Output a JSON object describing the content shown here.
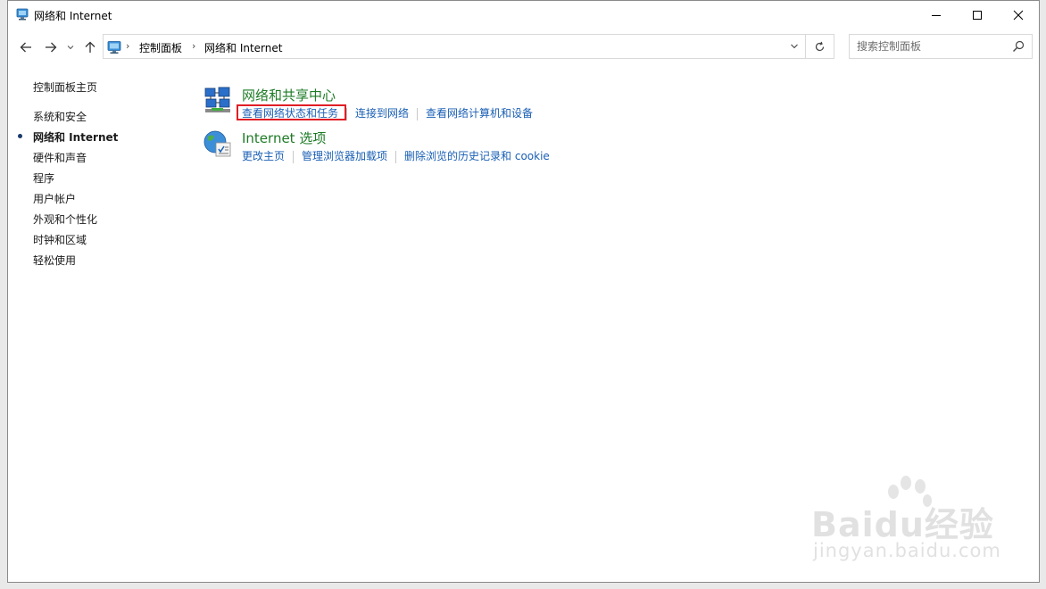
{
  "window": {
    "title": "网络和 Internet"
  },
  "address": {
    "crumbs": [
      "控制面板",
      "网络和 Internet"
    ]
  },
  "search": {
    "placeholder": "搜索控制面板"
  },
  "sidebar": {
    "home": "控制面板主页",
    "items": [
      {
        "label": "系统和安全",
        "active": false
      },
      {
        "label": "网络和 Internet",
        "active": true
      },
      {
        "label": "硬件和声音",
        "active": false
      },
      {
        "label": "程序",
        "active": false
      },
      {
        "label": "用户帐户",
        "active": false
      },
      {
        "label": "外观和个性化",
        "active": false
      },
      {
        "label": "时钟和区域",
        "active": false
      },
      {
        "label": "轻松使用",
        "active": false
      }
    ]
  },
  "categories": [
    {
      "title": "网络和共享中心",
      "icon": "network-sharing-icon",
      "links": [
        "查看网络状态和任务",
        "连接到网络",
        "查看网络计算机和设备"
      ]
    },
    {
      "title": "Internet 选项",
      "icon": "internet-options-icon",
      "links": [
        "更改主页",
        "管理浏览器加载项",
        "删除浏览的历史记录和 cookie"
      ]
    }
  ],
  "watermark": {
    "brand": "Baidu经验",
    "url": "jingyan.baidu.com"
  },
  "colors": {
    "link": "#1a5fb4",
    "category_title": "#1e7b26",
    "highlight": "#e01e25"
  }
}
